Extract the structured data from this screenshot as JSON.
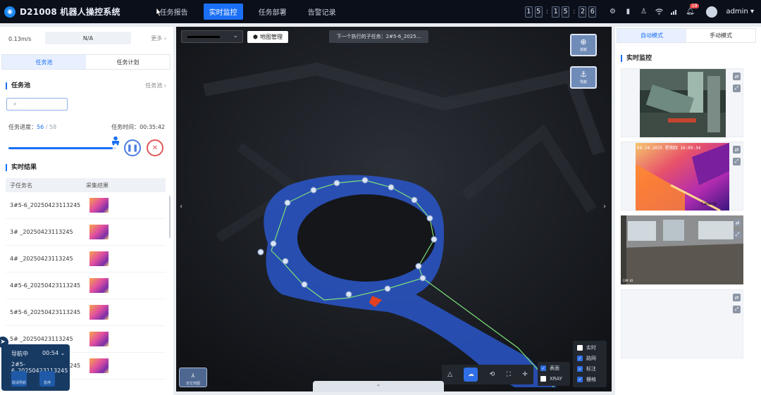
{
  "header": {
    "title": "D21008 机器人操控系统",
    "nav": [
      "任务报告",
      "实时监控",
      "任务部署",
      "告警记录"
    ],
    "active_nav": "实时监控",
    "clock": {
      "h1": "1",
      "h2": "5",
      "m1": "1",
      "m2": "5",
      "s1": "2",
      "s2": "6"
    },
    "notification_count": "19",
    "user": "admin"
  },
  "left": {
    "speed": "0.13m/s",
    "status": "N/A",
    "more": "更多",
    "tabs": [
      "任务池",
      "任务计划"
    ],
    "pool_title": "任务池",
    "pool_link": "任务池",
    "progress_label": "任务进度：",
    "progress_done": "56",
    "progress_total": "58",
    "time_label": "任务时间：",
    "time_value": "00:35:42",
    "progress_fraction": 0.965,
    "results_title": "实时结果",
    "col_task": "子任务名",
    "col_result": "采集结果",
    "rows": [
      "3#5-6_20250423113245",
      "3# _20250423113245",
      "4# _20250423113245",
      "4#5-6_20250423113245",
      "5#5-6_20250423113245",
      "5# _20250423113245",
      "6#5-6_20250423113245"
    ]
  },
  "navigation": {
    "state": "导航中",
    "time": "00:54",
    "task": "2#5-6_20250423113245",
    "cancel": "取消导航",
    "stop": "急停"
  },
  "map": {
    "management": "地图管理",
    "next_task": "下一个执行的子任务：2#5-6_2025...",
    "btn_return": "返航",
    "btn_nav": "导航",
    "minimap_label": "定位地图",
    "layers": {
      "realtime": "实时",
      "route": "路网",
      "marker": "标注",
      "grid": "栅格"
    },
    "surface": "表面",
    "xray": "XRAY"
  },
  "right": {
    "modes": [
      "自动模式",
      "手动模式"
    ],
    "monitor_title": "实时监控",
    "thermal_timestamp": "04-24-2025 星期四 16:09:34",
    "thermal_brand": "Camera",
    "cam3_label": "CAM 03"
  },
  "colors": {
    "accent": "#1a6ff5",
    "danger": "#e05757",
    "cloud": "#2a56c9",
    "route": "#7de07a"
  }
}
